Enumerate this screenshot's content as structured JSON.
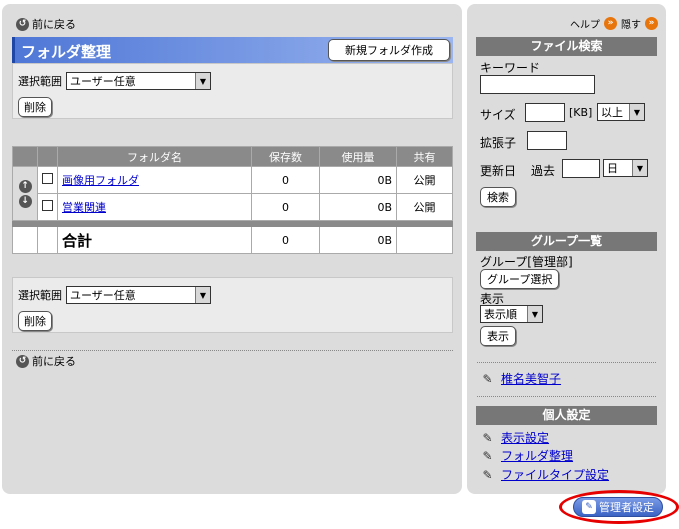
{
  "nav": {
    "back_label": "前に戻る"
  },
  "side_top": {
    "help_label": "ヘルプ",
    "hide_label": "隠す"
  },
  "folder_section": {
    "title": "フォルダ整理",
    "new_folder_button": "新規フォルダ作成",
    "range_label": "選択範囲",
    "range_selected": "ユーザー任意",
    "delete_button": "削除"
  },
  "table": {
    "headers": [
      "フォルダ名",
      "保存数",
      "使用量",
      "共有"
    ],
    "rows": [
      {
        "name": "画像用フォルダ",
        "count": "0",
        "usage": "0B",
        "share": "公開"
      },
      {
        "name": "営業関連",
        "count": "0",
        "usage": "0B",
        "share": "公開"
      }
    ],
    "total": {
      "label": "合計",
      "count": "0",
      "usage": "0B"
    }
  },
  "file_search": {
    "header": "ファイル検索",
    "keyword_label": "キーワード",
    "keyword_value": "",
    "size_label": "サイズ",
    "size_value": "",
    "size_unit": "[KB]",
    "size_compare_selected": "以上",
    "ext_label": "拡張子",
    "ext_value": "",
    "updated_label": "更新日",
    "past_label": "過去",
    "updated_value": "",
    "updated_unit_selected": "日",
    "search_button": "検索"
  },
  "group_list": {
    "header": "グループ一覧",
    "group_label": "グループ[管理部]",
    "select_button": "グループ選択",
    "display_label": "表示",
    "order_selected": "表示順",
    "display_button": "表示"
  },
  "user_link": "椎名美智子",
  "personal_settings": {
    "header": "個人設定",
    "links": [
      "表示設定",
      "フォルダ整理",
      "ファイルタイプ設定"
    ]
  },
  "admin_button": "管理者設定"
}
